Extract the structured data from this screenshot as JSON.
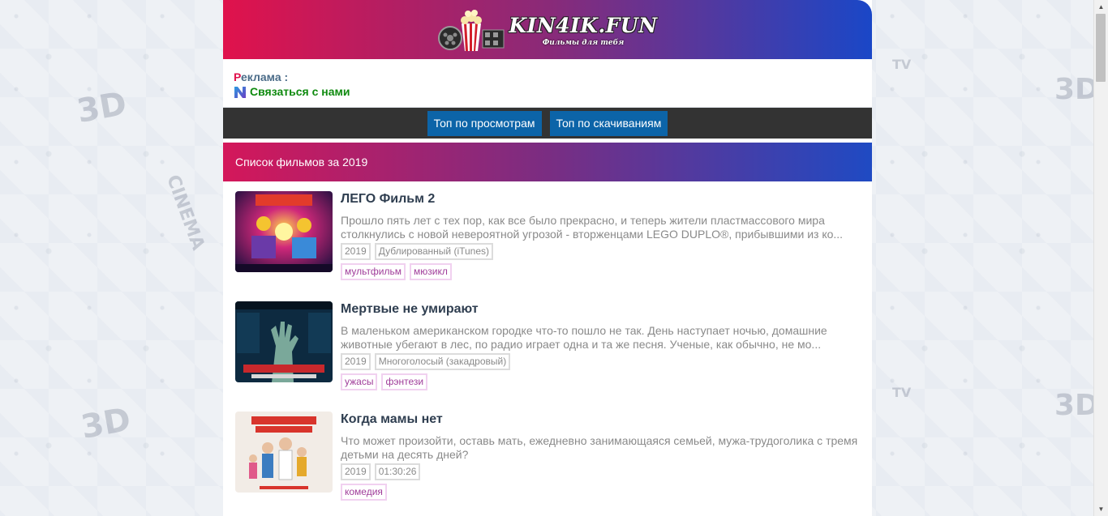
{
  "header": {
    "logo_title": "KIN4IK.FUN",
    "logo_subtitle": "Фильмы для тебя"
  },
  "ad": {
    "label_first": "Р",
    "label_rest": "еклама :",
    "contact_label": "Связаться с нами"
  },
  "nav": {
    "items": [
      {
        "label": "Топ по просмотрам"
      },
      {
        "label": "Топ по скачиваниям"
      }
    ]
  },
  "list": {
    "title": "Список фильмов за 2019",
    "movies": [
      {
        "title": "ЛЕГО Фильм 2",
        "description": "Прошло пять лет с тех пор, как все было прекрасно, и теперь жители пластмассового мира столкнулись с новой невероятной угрозой - вторженцами LEGO DUPLO®, прибывшими из ко...",
        "year": "2019",
        "extra": "Дублированный (iTunes)",
        "genres": [
          "мультфильм",
          "мюзикл"
        ],
        "poster_colors": [
          "#2a1450",
          "#d0287a",
          "#5a3aa8"
        ]
      },
      {
        "title": "Мертвые не умирают",
        "description": "В маленьком американском городке что-то пошло не так. День наступает ночью, домашние животные убегают в лес, по радио играет одна и та же песня. Ученые, как обычно, не мо...",
        "year": "2019",
        "extra": "Многоголосый (закадровый)",
        "genres": [
          "ужасы",
          "фэнтези"
        ],
        "poster_colors": [
          "#0c2d44",
          "#1c6a8a",
          "#c8282c"
        ]
      },
      {
        "title": "Когда мамы нет",
        "description": "Что может произойти, оставь мать, ежедневно занимающаяся семьей, мужа-трудоголика с тремя детьми на десять дней?",
        "year": "2019",
        "extra": "01:30:26",
        "genres": [
          "комедия"
        ],
        "poster_colors": [
          "#f2ece6",
          "#d8342c",
          "#3c7cc0"
        ]
      }
    ]
  }
}
